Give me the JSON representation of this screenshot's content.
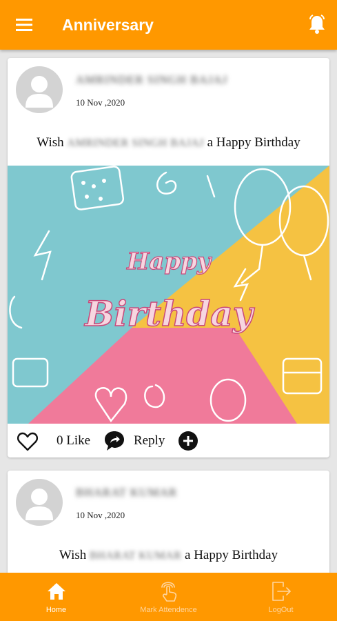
{
  "app": {
    "title": "Anniversary",
    "menu_icon": "hamburger-menu-icon",
    "bell_icon": "bell-icon"
  },
  "colors": {
    "primary": "#ff9800",
    "background": "#e6e6e6"
  },
  "posts": [
    {
      "name": "AMRINDER SINGH BAJAJ",
      "date": "10 Nov ,2020",
      "wish_prefix": "Wish",
      "wish_name": "AMRINDER SINGH BAJAJ",
      "wish_suffix": "a Happy Birthday",
      "banner_line1": "Happy",
      "banner_line2": "Birthday",
      "like_count": "0",
      "like_label": "Like",
      "reply_label": "Reply"
    },
    {
      "name": "BHARAT KUMAR",
      "date": "10 Nov ,2020",
      "wish_prefix": "Wish",
      "wish_name": "BHARAT KUMAR",
      "wish_suffix": "a Happy Birthday"
    }
  ],
  "bottom_nav": [
    {
      "label": "Home",
      "icon": "home-icon",
      "active": true
    },
    {
      "label": "Mark Attendence",
      "icon": "touch-icon",
      "active": false
    },
    {
      "label": "LogOut",
      "icon": "logout-icon",
      "active": false
    }
  ]
}
